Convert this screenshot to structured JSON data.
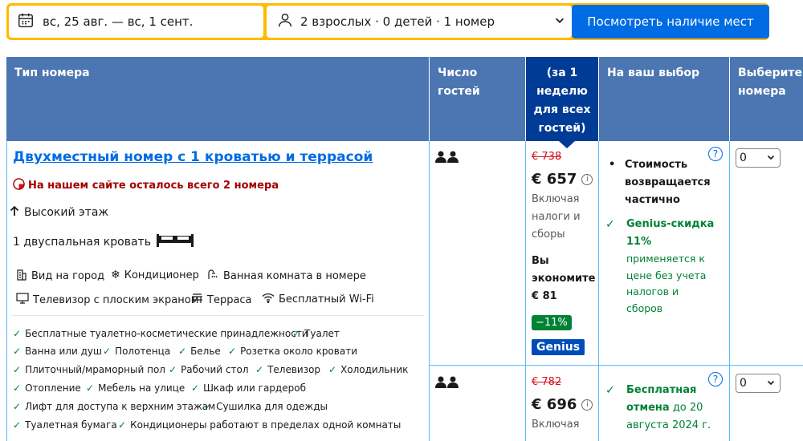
{
  "search": {
    "dates": "вс, 25 авг. — вс, 1 сент.",
    "guests": "2 взрослых · 0 детей · 1 номер",
    "button": "Посмотреть наличие мест"
  },
  "table": {
    "headers": {
      "room_type": "Тип номера",
      "guests": "Число гостей",
      "price": "(за 1 неделю для всех гостей)",
      "choice": "На ваш выбор",
      "select": "Выберите номера"
    }
  },
  "room": {
    "title": "Двухместный номер с 1 кроватью и террасой",
    "scarcity": "На нашем сайте осталось всего 2 номера",
    "floor": "Высокий этаж",
    "bed": "1 двуспальная кровать",
    "facilities": [
      "Вид на город",
      "Кондиционер",
      "Ванная комната в номере",
      "Телевизор с плоским экраном",
      "Терраса",
      "Бесплатный Wi-Fi"
    ],
    "amenities": [
      "Бесплатные туалетно-косметические принадлежности",
      "Туалет",
      "Ванна или душ",
      "Полотенца",
      "Белье",
      "Розетка около кровати",
      "Плиточный/мраморный пол",
      "Рабочий стол",
      "Телевизор",
      "Холодильник",
      "Отопление",
      "Мебель на улице",
      "Шкаф или гардероб",
      "Лифт для доступа к верхним этажам",
      "Сушилка для одежды",
      "Туалетная бумага",
      "Кондиционеры работают в пределах одной комнаты"
    ]
  },
  "offers": [
    {
      "old_price": "€ 738",
      "price": "€ 657",
      "taxes": "Включая налоги и сборы",
      "save_label": "Вы экономите € 81",
      "discount": "−11%",
      "genius": "Genius",
      "conditions": {
        "bullet": "Стоимость возвращается частично",
        "genius_title": "Genius-скидка 11%",
        "genius_note": "применяется к цене без учета налогов и сборов"
      },
      "select_value": "0"
    },
    {
      "old_price": "€ 782",
      "price": "€ 696",
      "taxes": "Включая",
      "cancel_title": "Бесплатная отмена",
      "cancel_note": "до 20 августа 2024 г.",
      "select_value": "0"
    }
  ],
  "colors": {
    "header_blue": "#4c76b2",
    "price_header": "#003b95",
    "accent": "#006ce4",
    "search_border": "#febb02",
    "danger": "#a30000",
    "success": "#008234"
  }
}
